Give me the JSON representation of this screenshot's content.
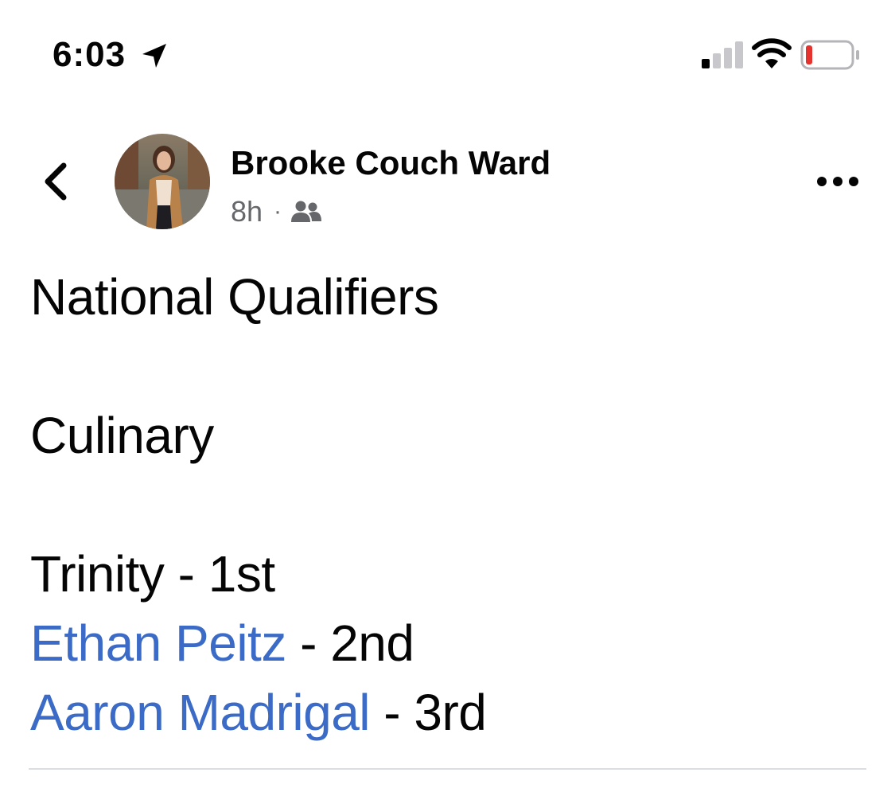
{
  "status_bar": {
    "time": "6:03",
    "battery_level": 0.12,
    "battery_color": "#e5342f",
    "icons": [
      "location-arrow-icon",
      "cellular-signal-icon",
      "wifi-icon",
      "battery-icon"
    ]
  },
  "post": {
    "author_name": "Brooke Couch Ward",
    "time_ago": "8h",
    "meta_separator": "·",
    "audience_icon": "friends-icon",
    "header_icons": [
      "chevron-left-icon",
      "more-options-icon"
    ],
    "lines": {
      "title": "National Qualifiers",
      "category": "Culinary",
      "result_1": "Trinity - 1st",
      "result_2_name": "Ethan Peitz",
      "result_2_place": " - 2nd",
      "result_3_name": "Aaron Madrigal",
      "result_3_place": " - 3rd"
    }
  },
  "colors": {
    "mention_link": "#3b6bc6",
    "text_primary": "#050505",
    "text_secondary": "#65676b",
    "divider": "#dadde1"
  }
}
